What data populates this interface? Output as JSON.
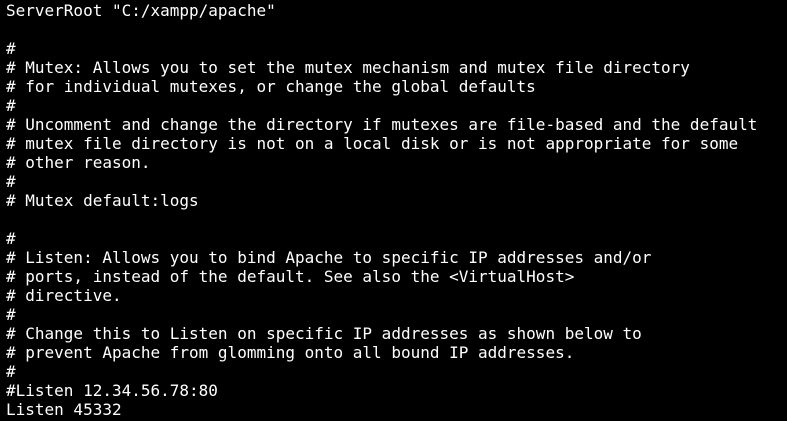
{
  "terminal": {
    "text_color": "#ffffff",
    "background_color": "#000000",
    "lines": [
      "ServerRoot \"C:/xampp/apache\"",
      "",
      "#",
      "# Mutex: Allows you to set the mutex mechanism and mutex file directory",
      "# for individual mutexes, or change the global defaults",
      "#",
      "# Uncomment and change the directory if mutexes are file-based and the default",
      "# mutex file directory is not on a local disk or is not appropriate for some",
      "# other reason.",
      "#",
      "# Mutex default:logs",
      "",
      "#",
      "# Listen: Allows you to bind Apache to specific IP addresses and/or",
      "# ports, instead of the default. See also the <VirtualHost>",
      "# directive.",
      "#",
      "# Change this to Listen on specific IP addresses as shown below to",
      "# prevent Apache from glomming onto all bound IP addresses.",
      "#",
      "#Listen 12.34.56.78:80",
      "Listen 45332"
    ]
  }
}
